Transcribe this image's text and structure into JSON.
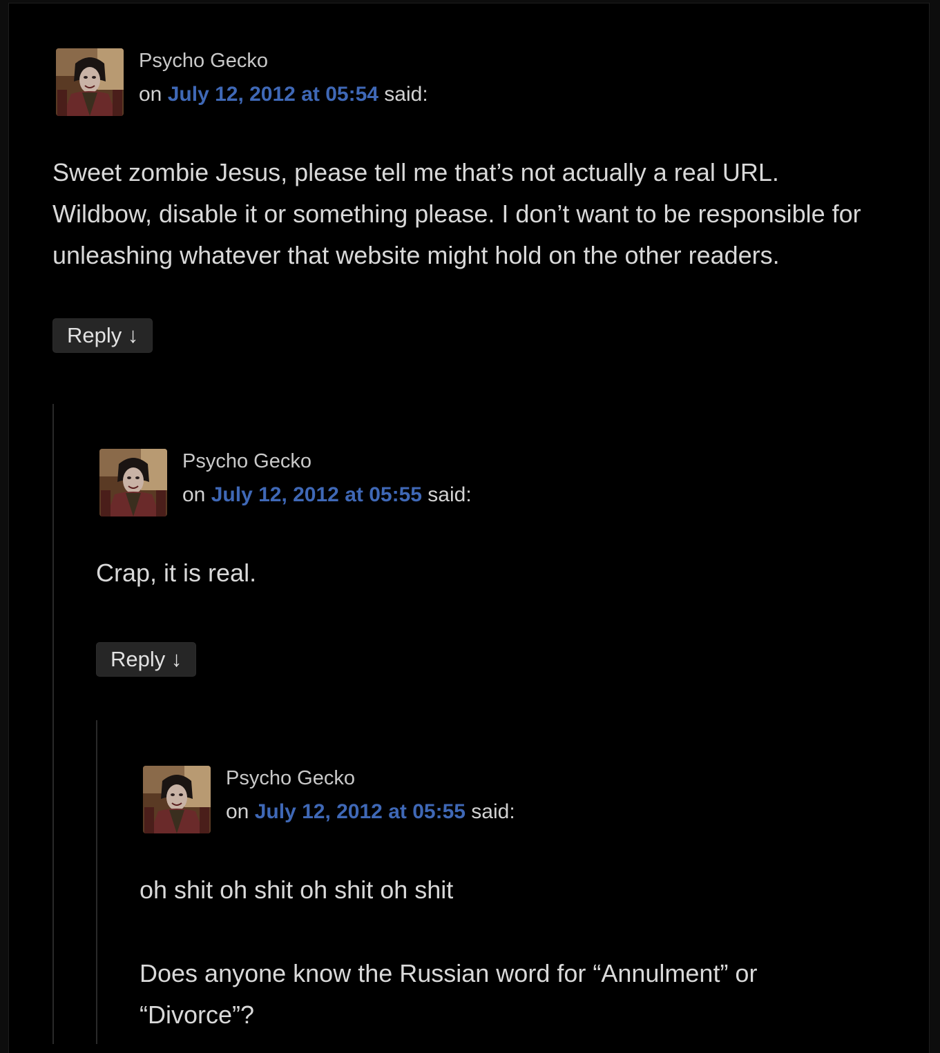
{
  "comments": [
    {
      "author": "Psycho Gecko",
      "on_prefix": "on",
      "date": "July 12, 2012 at 05:54",
      "said": "said:",
      "paragraphs": [
        "Sweet zombie Jesus, please tell me that’s not actually a real URL. Wildbow, disable it or something please. I don’t want to be responsible for unleashing whatever that website might hold on the other readers."
      ],
      "reply_label": "Reply ↓"
    },
    {
      "author": "Psycho Gecko",
      "on_prefix": "on",
      "date": "July 12, 2012 at 05:55",
      "said": "said:",
      "paragraphs": [
        "Crap, it is real."
      ],
      "reply_label": "Reply ↓"
    },
    {
      "author": "Psycho Gecko",
      "on_prefix": "on",
      "date": "July 12, 2012 at 05:55",
      "said": "said:",
      "paragraphs": [
        "oh shit oh shit oh shit oh shit",
        "Does anyone know the Russian word for “Annulment” or “Divorce”?"
      ]
    }
  ],
  "colors": {
    "background": "#000000",
    "link": "#3f68b6",
    "text": "#d9d9d9",
    "button_bg": "#262626",
    "thread_line": "#2a2a2a"
  },
  "icons": {
    "avatar": "commenter-avatar-photo"
  }
}
